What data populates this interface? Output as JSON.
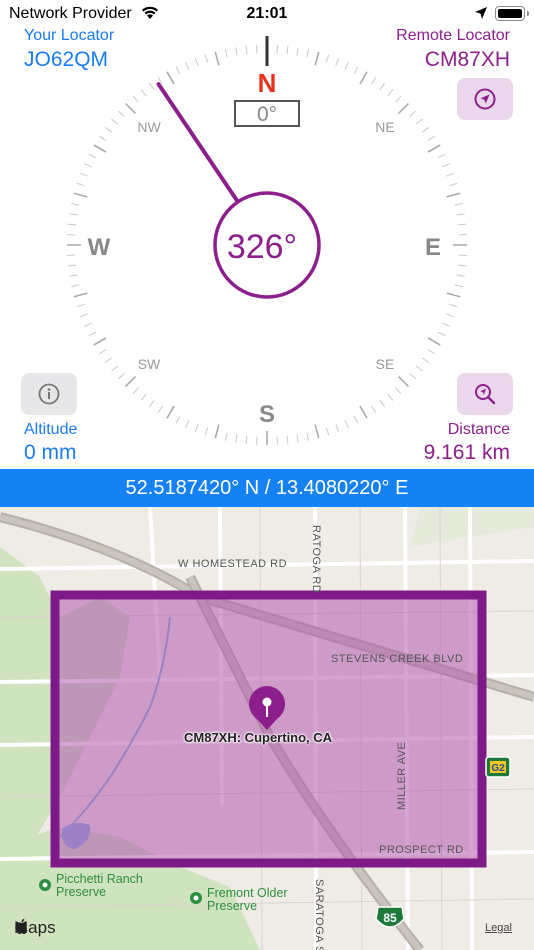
{
  "status": {
    "carrier": "Network Provider",
    "time": "21:01"
  },
  "your_locator": {
    "label": "Your Locator",
    "value": "JO62QM"
  },
  "remote_locator": {
    "label": "Remote Locator",
    "value": "CM87XH"
  },
  "compass": {
    "north_marker": "N",
    "heading_readout": "0°",
    "bearing_readout": "326°",
    "bearing_degrees": 326,
    "cardinals": {
      "N": "N",
      "E": "E",
      "S": "S",
      "W": "W",
      "NE": "NE",
      "NW": "NW",
      "SE": "SE",
      "SW": "SW"
    }
  },
  "altitude": {
    "label": "Altitude",
    "value": "0 mm"
  },
  "distance": {
    "label": "Distance",
    "value": "9.161 km"
  },
  "coordinates": "52.5187420° N / 13.4080220° E",
  "map": {
    "streets": {
      "homestead": "W HOMESTEAD RD",
      "saratoga_top": "RATOGA RD",
      "stevens_creek": "STEVENS CREEK BLVD",
      "miller": "MILLER AVE",
      "prospect": "PROSPECT RD",
      "saratoga_bottom": "SARATOGA S"
    },
    "pin_label": "CM87XH: Cupertino, CA",
    "pois": [
      "Picchetti Ranch Preserve",
      "Fremont Older Preserve"
    ],
    "highway_85": "85",
    "highway_g2": "G2",
    "attribution": "Maps",
    "legal": "Legal"
  },
  "colors": {
    "accent_blue": "#1a7cf0",
    "accent_purple": "#8c1f8c",
    "north_red": "#e8321e"
  }
}
